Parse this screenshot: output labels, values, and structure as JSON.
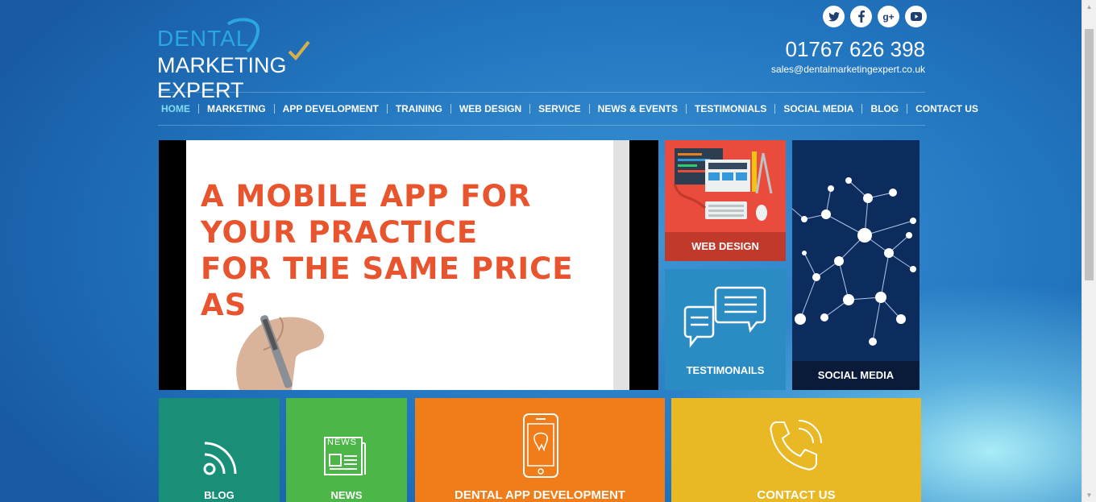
{
  "logo": {
    "line1": "DENTAL",
    "line2": "MARKETING EXPERT"
  },
  "social": [
    {
      "name": "twitter-icon",
      "glyph": "t"
    },
    {
      "name": "facebook-icon",
      "glyph": "f"
    },
    {
      "name": "google-plus-icon",
      "glyph": "g+"
    },
    {
      "name": "youtube-icon",
      "glyph": "▶"
    }
  ],
  "contact": {
    "phone": "01767 626 398",
    "email": "sales@dentalmarketingexpert.co.uk"
  },
  "nav": [
    "HOME",
    "MARKETING",
    "APP DEVELOPMENT",
    "TRAINING",
    "WEB DESIGN",
    "SERVICE",
    "NEWS & EVENTS",
    "TESTIMONIALS",
    "SOCIAL MEDIA",
    "BLOG",
    "CONTACT US"
  ],
  "video": {
    "lines": [
      "A MOBILE APP FOR",
      "YOUR PRACTICE",
      "FOR THE SAME PRICE",
      "AS"
    ]
  },
  "tiles": {
    "web_design": "WEB DESIGN",
    "testimonials": "TESTIMONAILS",
    "social_media": "SOCIAL MEDIA",
    "blog": "BLOG",
    "news": "NEWS",
    "news_icon_text": "NEWS",
    "app_dev": "DENTAL APP DEVELOPMENT",
    "contact": "CONTACT US"
  },
  "colors": {
    "web": "#e94b3c",
    "testimonials": "#2b8cc4",
    "blog": "#1a8f78",
    "news": "#4cb748",
    "appdev": "#f07d1a",
    "contact": "#e9b825",
    "video_text": "#e8542e"
  }
}
